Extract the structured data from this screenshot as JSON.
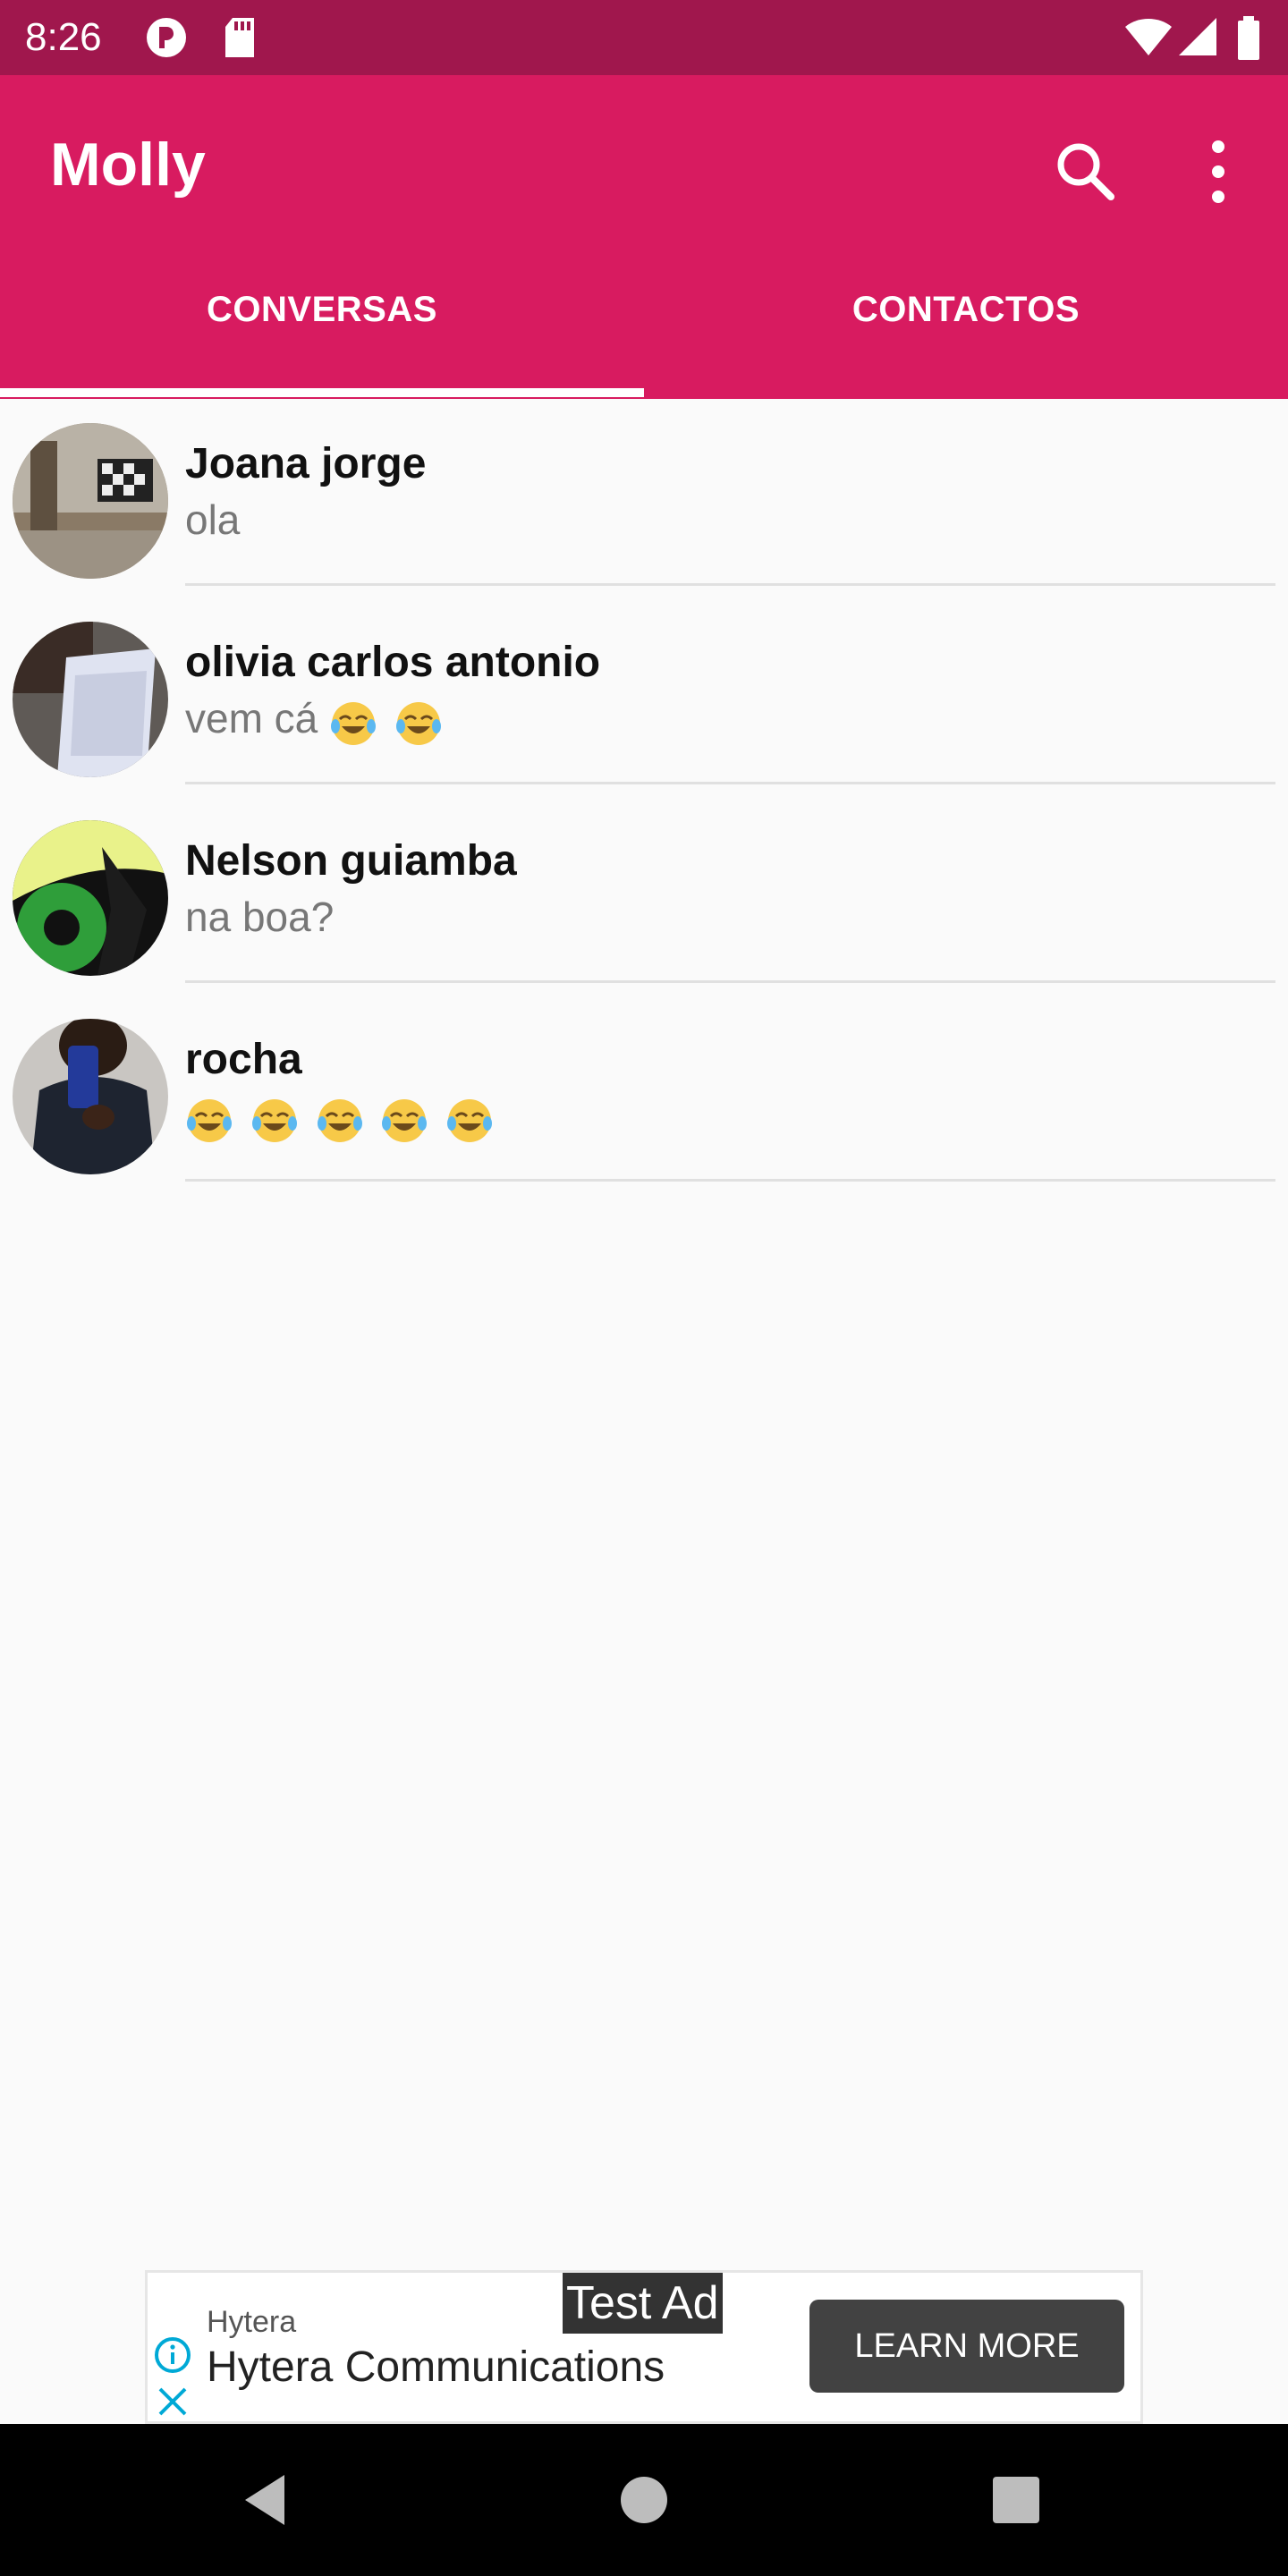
{
  "status_bar": {
    "time": "8:26",
    "icons": [
      "notification-app-icon",
      "sd-card-icon",
      "wifi-icon",
      "signal-icon",
      "battery-icon"
    ]
  },
  "app_bar": {
    "title": "Molly",
    "actions": [
      "search-icon",
      "more-vert-icon"
    ],
    "color": "#d81b60"
  },
  "tabs": [
    {
      "label": "CONVERSAS",
      "selected": true
    },
    {
      "label": "CONTACTOS",
      "selected": false
    }
  ],
  "conversations": [
    {
      "name": "Joana jorge",
      "preview": "ola",
      "emoji_count": 0
    },
    {
      "name": "olivia carlos antonio",
      "preview": "vem cá",
      "emoji_count": 2
    },
    {
      "name": "Nelson guiamba",
      "preview": "na boa?",
      "emoji_count": 0
    },
    {
      "name": "rocha",
      "preview": "",
      "emoji_count": 5
    }
  ],
  "ad": {
    "test_label": "Test Ad",
    "sponsor": "Hytera",
    "title": "Hytera Communications",
    "cta": "LEARN MORE"
  },
  "nav_bar": {
    "buttons": [
      "back-icon",
      "home-icon",
      "recents-icon"
    ]
  }
}
